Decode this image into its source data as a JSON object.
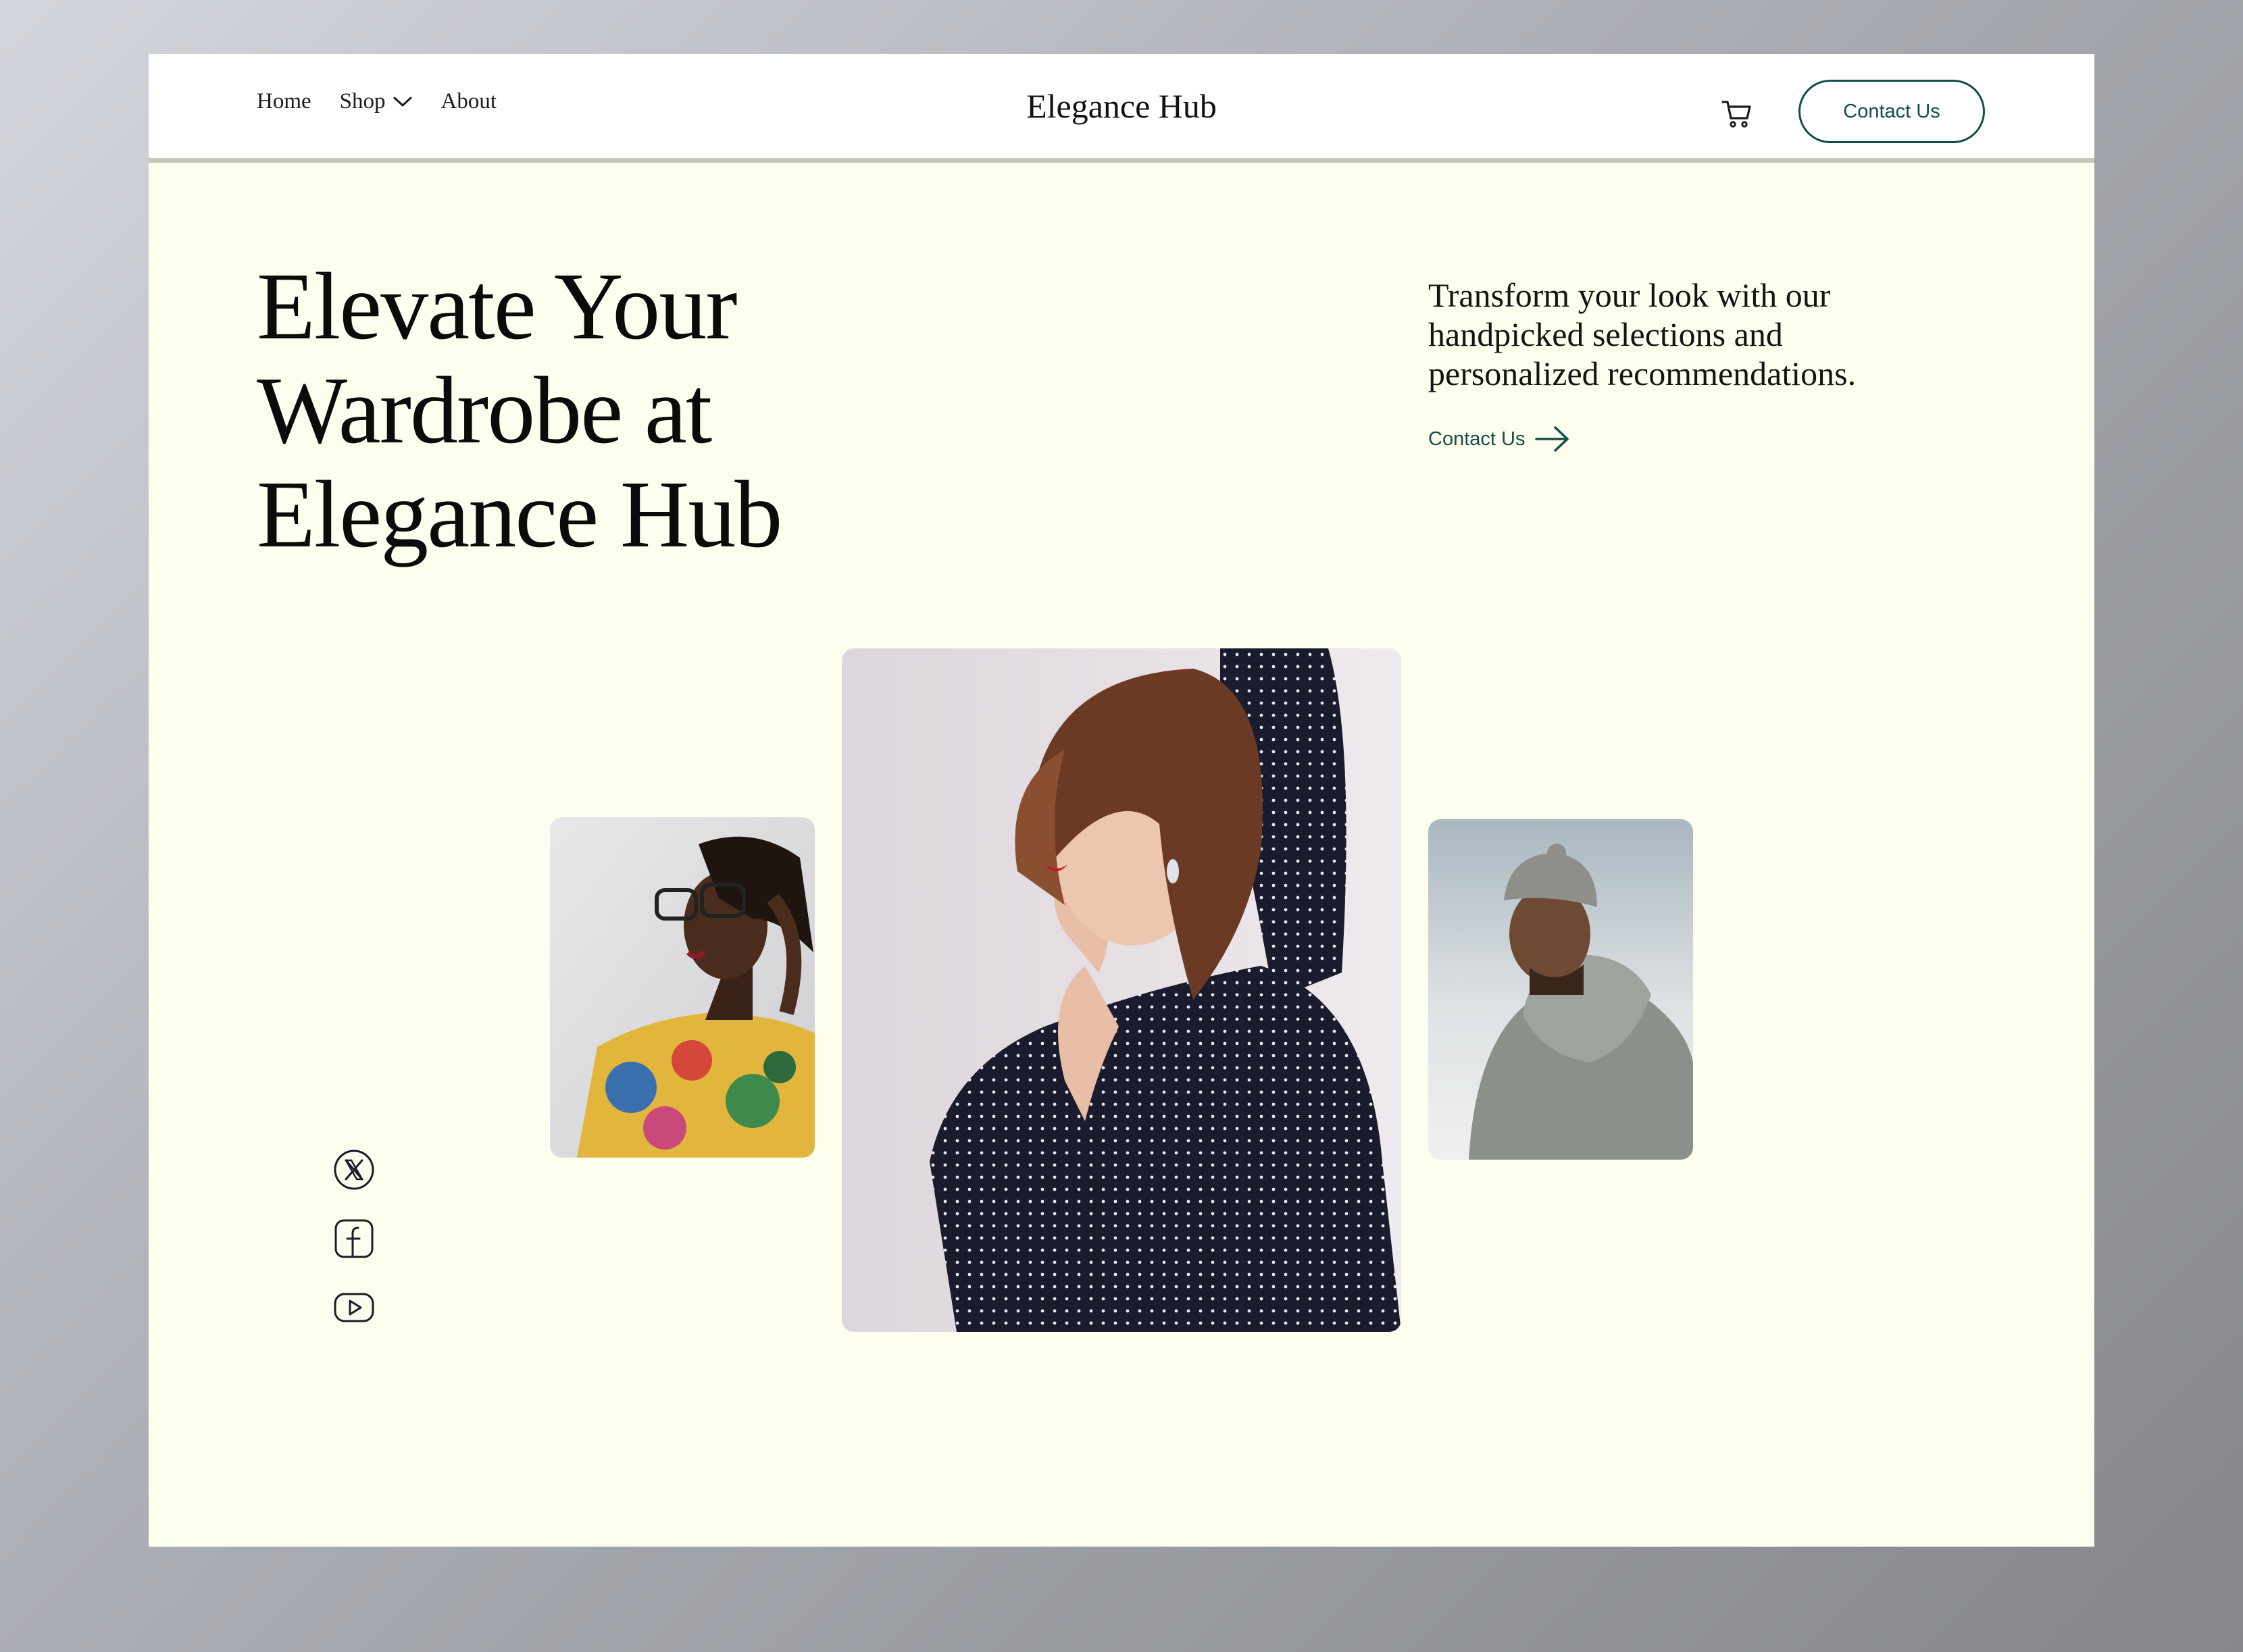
{
  "nav": {
    "items": [
      {
        "label": "Home"
      },
      {
        "label": "Shop"
      },
      {
        "label": "About"
      }
    ]
  },
  "brand": {
    "title": "Elegance Hub"
  },
  "header": {
    "contact_label": "Contact Us"
  },
  "hero": {
    "title_lines": [
      "Elevate Your",
      "Wardrobe at",
      "Elegance Hub"
    ],
    "subtitle": "Transform your look with our handpicked selections and personalized recommendations.",
    "link_label": "Contact Us"
  },
  "icons": {
    "cart": "cart-icon",
    "chevron": "chevron-down-icon",
    "arrow": "arrow-right-icon",
    "social": [
      "x-twitter-icon",
      "facebook-icon",
      "youtube-icon"
    ]
  },
  "colors": {
    "accent": "#134e4a",
    "background": "#fefeee",
    "header": "#ffffff"
  }
}
